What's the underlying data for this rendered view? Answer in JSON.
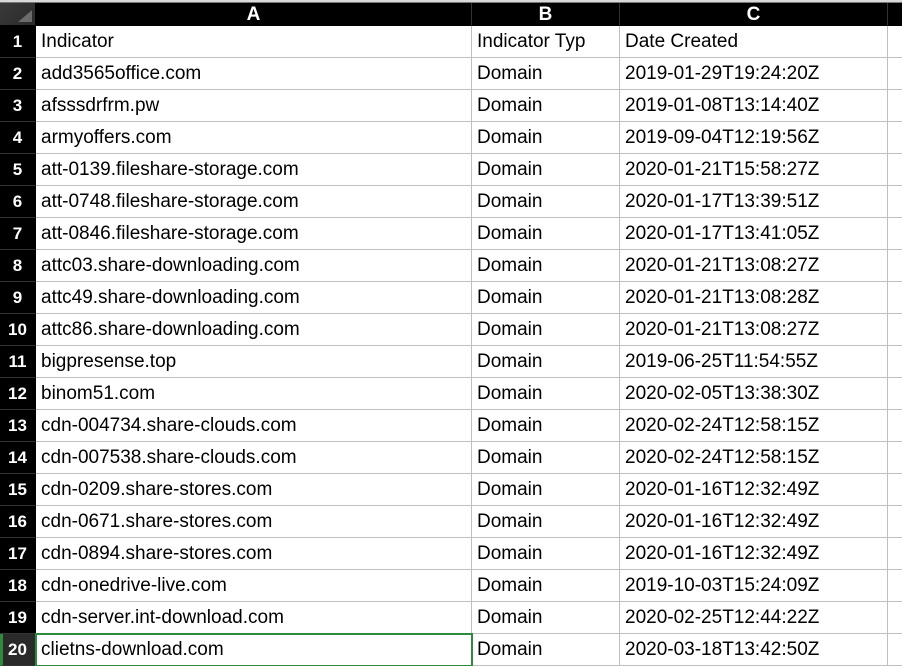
{
  "columns": [
    "A",
    "B",
    "C"
  ],
  "header_row": {
    "A": "Indicator",
    "B": "Indicator Typ",
    "C": "Date Created"
  },
  "active_cell": {
    "row": 20,
    "col": "A"
  },
  "rows": [
    {
      "n": 1,
      "A": "Indicator",
      "B": "Indicator Typ",
      "C": "Date Created"
    },
    {
      "n": 2,
      "A": "add3565office.com",
      "B": "Domain",
      "C": "2019-01-29T19:24:20Z"
    },
    {
      "n": 3,
      "A": "afsssdrfrm.pw",
      "B": "Domain",
      "C": "2019-01-08T13:14:40Z"
    },
    {
      "n": 4,
      "A": "armyoffers.com",
      "B": "Domain",
      "C": "2019-09-04T12:19:56Z"
    },
    {
      "n": 5,
      "A": "att-0139.fileshare-storage.com",
      "B": "Domain",
      "C": "2020-01-21T15:58:27Z"
    },
    {
      "n": 6,
      "A": "att-0748.fileshare-storage.com",
      "B": "Domain",
      "C": "2020-01-17T13:39:51Z"
    },
    {
      "n": 7,
      "A": "att-0846.fileshare-storage.com",
      "B": "Domain",
      "C": "2020-01-17T13:41:05Z"
    },
    {
      "n": 8,
      "A": "attc03.share-downloading.com",
      "B": "Domain",
      "C": "2020-01-21T13:08:27Z"
    },
    {
      "n": 9,
      "A": "attc49.share-downloading.com",
      "B": "Domain",
      "C": "2020-01-21T13:08:28Z"
    },
    {
      "n": 10,
      "A": "attc86.share-downloading.com",
      "B": "Domain",
      "C": "2020-01-21T13:08:27Z"
    },
    {
      "n": 11,
      "A": "bigpresense.top",
      "B": "Domain",
      "C": "2019-06-25T11:54:55Z"
    },
    {
      "n": 12,
      "A": "binom51.com",
      "B": "Domain",
      "C": "2020-02-05T13:38:30Z"
    },
    {
      "n": 13,
      "A": "cdn-004734.share-clouds.com",
      "B": "Domain",
      "C": "2020-02-24T12:58:15Z"
    },
    {
      "n": 14,
      "A": "cdn-007538.share-clouds.com",
      "B": "Domain",
      "C": "2020-02-24T12:58:15Z"
    },
    {
      "n": 15,
      "A": "cdn-0209.share-stores.com",
      "B": "Domain",
      "C": "2020-01-16T12:32:49Z"
    },
    {
      "n": 16,
      "A": "cdn-0671.share-stores.com",
      "B": "Domain",
      "C": "2020-01-16T12:32:49Z"
    },
    {
      "n": 17,
      "A": "cdn-0894.share-stores.com",
      "B": "Domain",
      "C": "2020-01-16T12:32:49Z"
    },
    {
      "n": 18,
      "A": "cdn-onedrive-live.com",
      "B": "Domain",
      "C": "2019-10-03T15:24:09Z"
    },
    {
      "n": 19,
      "A": "cdn-server.int-download.com",
      "B": "Domain",
      "C": "2020-02-25T12:44:22Z"
    },
    {
      "n": 20,
      "A": "clietns-download.com",
      "B": "Domain",
      "C": "2020-03-18T13:42:50Z"
    }
  ]
}
